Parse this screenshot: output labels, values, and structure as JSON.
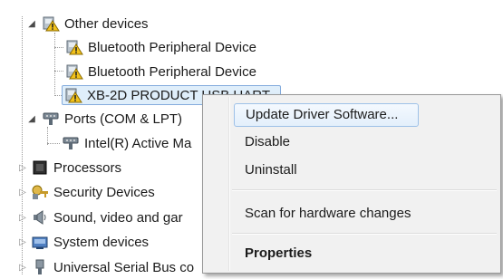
{
  "tree": {
    "other_devices": {
      "label": "Other devices",
      "children": [
        "Bluetooth Peripheral Device",
        "Bluetooth Peripheral Device",
        "XB-2D PRODUCT USB UART"
      ]
    },
    "ports": {
      "label": "Ports (COM & LPT)",
      "child": "Intel(R) Active Ma"
    },
    "processors": "Processors",
    "security": "Security Devices",
    "sound": "Sound, video and gar",
    "system": "System devices",
    "usb": "Universal Serial Bus co"
  },
  "context_menu": {
    "update_driver": "Update Driver Software...",
    "disable": "Disable",
    "uninstall": "Uninstall",
    "scan": "Scan for hardware changes",
    "properties": "Properties"
  },
  "icons": {
    "expanded": "triangle-down-icon",
    "collapsed": "triangle-right-icon",
    "warning_device": "unknown-device-warning-icon",
    "port": "port-connector-icon",
    "processor": "processor-chip-icon",
    "security": "security-key-icon",
    "sound": "speaker-icon",
    "system": "system-folder-icon",
    "usb": "usb-plug-icon"
  },
  "colors": {
    "selection_bg": "#dfeefa",
    "selection_border": "#84acdd",
    "menu_bg": "#f1f1f1",
    "menu_highlight_border": "#9ec1e8",
    "warning_yellow": "#f2c21b"
  }
}
